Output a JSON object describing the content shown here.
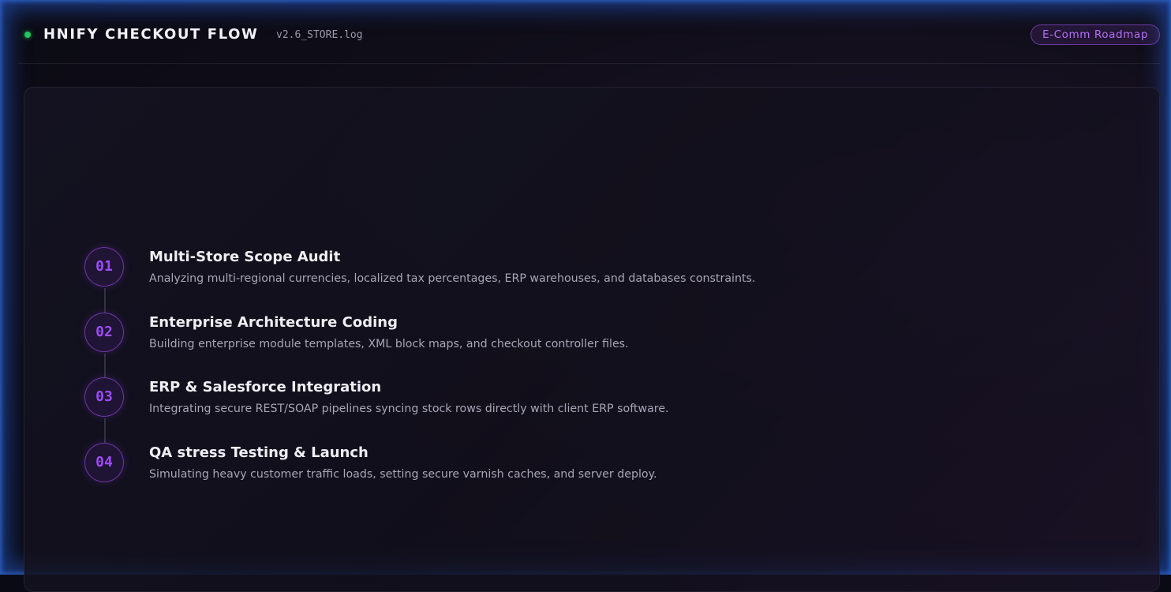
{
  "header": {
    "title": "HNIFY CHECKOUT FLOW",
    "log_file": "v2.6_STORE.log",
    "badge": "E-Comm Roadmap",
    "status_color": "#22c55e"
  },
  "colors": {
    "accent": "#a855f7",
    "background": "#0f0d18"
  },
  "steps": [
    {
      "number": "01",
      "title": "Multi-Store Scope Audit",
      "description": "Analyzing multi-regional currencies, localized tax percentages, ERP warehouses, and databases constraints."
    },
    {
      "number": "02",
      "title": "Enterprise Architecture Coding",
      "description": "Building enterprise module templates, XML block maps, and checkout controller files."
    },
    {
      "number": "03",
      "title": "ERP & Salesforce Integration",
      "description": "Integrating secure REST/SOAP pipelines syncing stock rows directly with client ERP software."
    },
    {
      "number": "04",
      "title": "QA stress Testing & Launch",
      "description": "Simulating heavy customer traffic loads, setting secure varnish caches, and server deploy."
    }
  ]
}
